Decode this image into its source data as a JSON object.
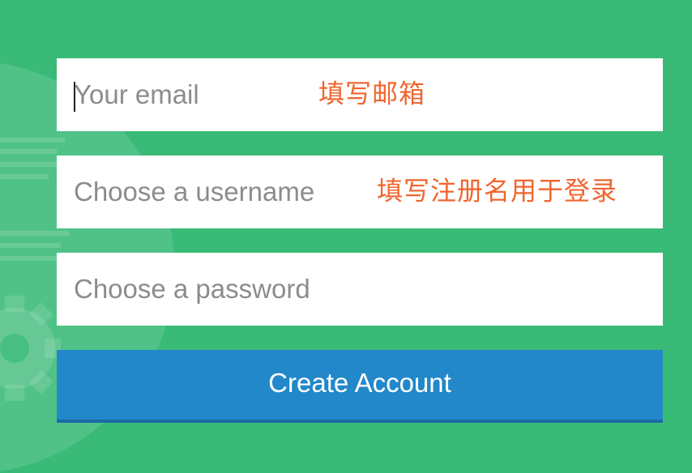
{
  "form": {
    "email": {
      "placeholder": "Your email",
      "value": "",
      "annotation": "填写邮箱"
    },
    "username": {
      "placeholder": "Choose a username",
      "value": "",
      "annotation": "填写注册名用于登录"
    },
    "password": {
      "placeholder": "Choose a password",
      "value": ""
    },
    "submit_label": "Create Account"
  },
  "colors": {
    "background": "#3aba77",
    "button": "#2288c9",
    "annotation": "#f0652f"
  }
}
